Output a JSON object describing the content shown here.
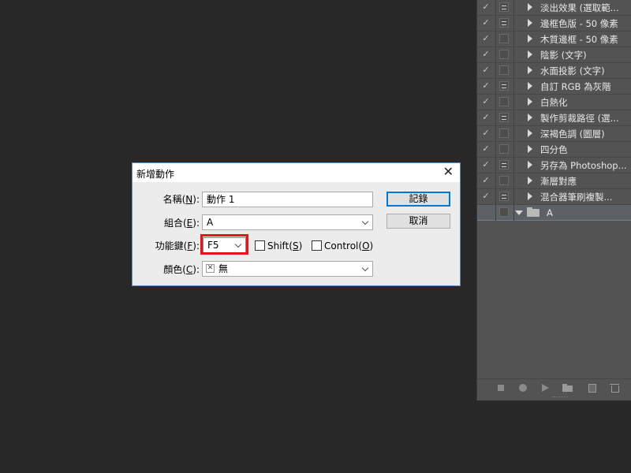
{
  "actions_panel": {
    "rows": [
      {
        "label": "淡出效果 (選取範...",
        "checked": true,
        "dialog": true
      },
      {
        "label": "邊框色版 - 50 像素",
        "checked": true,
        "dialog": true
      },
      {
        "label": "木質邊框 - 50 像素",
        "checked": true,
        "dialog": false
      },
      {
        "label": "陰影 (文字)",
        "checked": true,
        "dialog": false
      },
      {
        "label": "水面投影 (文字)",
        "checked": true,
        "dialog": false
      },
      {
        "label": "自訂 RGB 為灰階",
        "checked": true,
        "dialog": true
      },
      {
        "label": "白熱化",
        "checked": true,
        "dialog": false
      },
      {
        "label": "製作剪裁路徑 (選...",
        "checked": true,
        "dialog": true
      },
      {
        "label": "深褐色調 (圖層)",
        "checked": true,
        "dialog": false
      },
      {
        "label": "四分色",
        "checked": true,
        "dialog": false
      },
      {
        "label": "另存為 Photoshop...",
        "checked": true,
        "dialog": true
      },
      {
        "label": "漸層對應",
        "checked": true,
        "dialog": false
      },
      {
        "label": "混合器筆刷複製...",
        "checked": true,
        "dialog": true
      }
    ],
    "new_set": {
      "label": "A",
      "checked": false,
      "dialog": false
    },
    "check_glyph": "✓"
  },
  "dialog": {
    "title": "新增動作",
    "close_glyph": "✕",
    "name": {
      "label_pre": "名稱(",
      "key": "N",
      "label_post": "):",
      "value": "動作 1"
    },
    "set": {
      "label_pre": "組合(",
      "key": "E",
      "label_post": "):",
      "value": "A"
    },
    "function_key": {
      "label_pre": "功能鍵(",
      "key": "F",
      "label_post": "):",
      "value": "F5"
    },
    "shift": {
      "label_pre": "Shift(",
      "key": "S",
      "label_post": ")",
      "checked": false
    },
    "control": {
      "label_pre": "Control(",
      "key": "O",
      "label_post": ")",
      "checked": false
    },
    "color": {
      "label_pre": "顏色(",
      "key": "C",
      "label_post": "):",
      "value": "無",
      "swatch_glyph": "✕"
    },
    "record_button": "記錄",
    "cancel_button": "取消",
    "highlight_color": "#e8131b"
  }
}
